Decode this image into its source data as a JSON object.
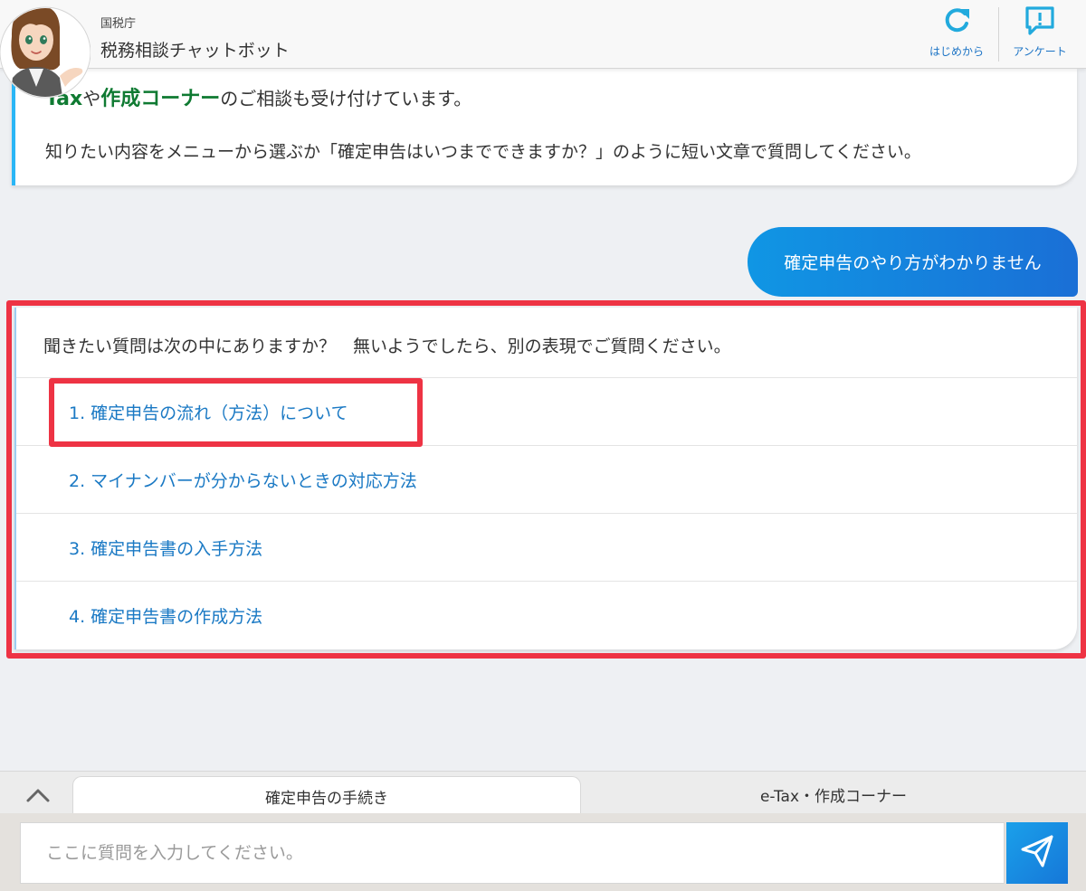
{
  "header": {
    "agency": "国税庁",
    "title": "税務相談チャットボット",
    "restart_label": "はじめから",
    "survey_label": "アンケート"
  },
  "messages": {
    "intro": {
      "hl1": "Tax",
      "mid1": "や",
      "hl2": "作成コーナー",
      "rest1": "のご相談も受け付けています。",
      "line2": "知りたい内容をメニューから選ぶか「確定申告はいつまでできますか？」のように短い文章で質問してください。"
    },
    "user": "確定申告のやり方がわかりません",
    "reply": {
      "question": "聞きたい質問は次の中にありますか？　無いようでしたら、別の表現でご質問ください。",
      "options": [
        "1. 確定申告の流れ（方法）について",
        "2. マイナンバーが分からないときの対応方法",
        "3. 確定申告書の入手方法",
        "4. 確定申告書の作成方法"
      ]
    }
  },
  "tabs": [
    "確定申告の手続き",
    "e-Tax・作成コーナー"
  ],
  "input": {
    "placeholder": "ここに質問を入力してください。",
    "value": ""
  },
  "colors": {
    "accent_blue": "#1a79c4",
    "highlight_red": "#ee3344",
    "brand_green": "#0f7a32",
    "header_icon": "#22aadd"
  }
}
